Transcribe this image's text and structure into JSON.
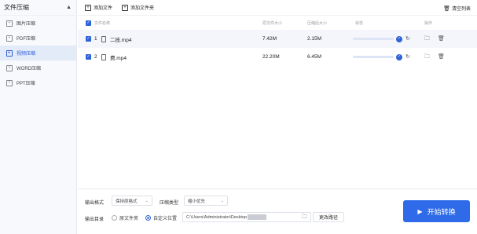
{
  "sidebar": {
    "title": "文件压缩",
    "items": [
      {
        "label": "图片压缩",
        "icon": "image-icon"
      },
      {
        "label": "PDF压缩",
        "icon": "pdf-icon"
      },
      {
        "label": "视频压缩",
        "icon": "video-icon",
        "active": true
      },
      {
        "label": "WORD压缩",
        "icon": "word-icon"
      },
      {
        "label": "PPT压缩",
        "icon": "ppt-icon"
      }
    ]
  },
  "toolbar": {
    "add_file_label": "添加文件",
    "add_folder_label": "添加文件夹",
    "clear_list_label": "清空列表"
  },
  "table": {
    "headers": {
      "name": "文件名称",
      "original_size": "原文件大小",
      "compressed_size": "压缩后大小",
      "status": "状态",
      "action": "操作"
    },
    "rows": [
      {
        "index": "1",
        "name": "二技.mp4",
        "original_size": "7.42M",
        "compressed_size": "2.15M",
        "progress": 1.0
      },
      {
        "index": "2",
        "name": "费.mp4",
        "original_size": "22.20M",
        "compressed_size": "6.45M",
        "progress": 1.0
      }
    ]
  },
  "bottom": {
    "output_format_label": "输出格式",
    "output_format_value": "保持原格式",
    "compress_type_label": "压缩类型",
    "compress_type_value": "缩小优先",
    "output_dir_label": "输出目录",
    "radio_original": "原文件夹",
    "radio_custom": "自定义位置",
    "path_value": "C:\\Users\\Administrator\\Desktop",
    "change_path_label": "更改路径",
    "start_label": "开始转换"
  },
  "colors": {
    "accent": "#2f63d9",
    "start_button": "#2f6be8",
    "sidebar_bg": "#f7f9fc",
    "active_bg": "#e3eaf8"
  }
}
